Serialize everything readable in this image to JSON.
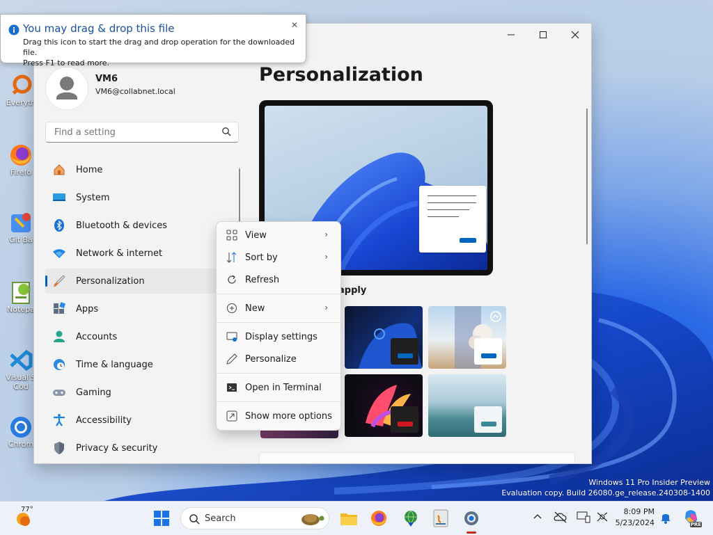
{
  "tooltip": {
    "title": "You may drag & drop this file",
    "line1": "Drag this icon to start the drag and drop operation for the downloaded file.",
    "line2": "Press F1 to read more."
  },
  "desktop_icons": [
    {
      "label": "Everyth",
      "icon": "search-app-icon"
    },
    {
      "label": "Firefo",
      "icon": "firefox-icon"
    },
    {
      "label": "Git Ba",
      "icon": "git-bash-icon"
    },
    {
      "label": "Notepa",
      "icon": "notepad-plus-icon"
    },
    {
      "label": "Visual S",
      "label2": "Cod",
      "icon": "vscode-icon"
    },
    {
      "label": "Chrom",
      "icon": "chrome-icon"
    }
  ],
  "settings": {
    "user_name": "VM6",
    "user_email": "VM6@collabnet.local",
    "search_placeholder": "Find a setting",
    "nav": [
      {
        "label": "Home",
        "icon": "home-icon"
      },
      {
        "label": "System",
        "icon": "system-icon"
      },
      {
        "label": "Bluetooth & devices",
        "icon": "bluetooth-icon"
      },
      {
        "label": "Network & internet",
        "icon": "wifi-icon"
      },
      {
        "label": "Personalization",
        "icon": "brush-icon",
        "active": true
      },
      {
        "label": "Apps",
        "icon": "apps-icon"
      },
      {
        "label": "Accounts",
        "icon": "accounts-icon"
      },
      {
        "label": "Time & language",
        "icon": "globe-clock-icon"
      },
      {
        "label": "Gaming",
        "icon": "gamepad-icon"
      },
      {
        "label": "Accessibility",
        "icon": "accessibility-icon"
      },
      {
        "label": "Privacy & security",
        "icon": "shield-icon"
      }
    ],
    "page_title": "Personalization",
    "theme_heading": "apply"
  },
  "context_menu": {
    "items": [
      {
        "label": "View",
        "icon": "grid-icon",
        "submenu": true
      },
      {
        "label": "Sort by",
        "icon": "sort-icon",
        "submenu": true
      },
      {
        "label": "Refresh",
        "icon": "refresh-icon",
        "submenu": false
      },
      {
        "label": "New",
        "icon": "plus-circle-icon",
        "submenu": true
      },
      {
        "label": "Display settings",
        "icon": "display-icon",
        "submenu": false
      },
      {
        "label": "Personalize",
        "icon": "pen-icon",
        "submenu": false
      },
      {
        "label": "Open in Terminal",
        "icon": "terminal-icon",
        "submenu": false
      },
      {
        "label": "Show more options",
        "icon": "more-options-icon",
        "submenu": false
      }
    ]
  },
  "watermark": {
    "line1": "Windows 11 Pro Insider Preview",
    "line2": "Evaluation copy. Build 26080.ge_release.240308-1400"
  },
  "taskbar": {
    "weather_temp": "77°",
    "search_label": "Search",
    "time": "8:09 PM",
    "date": "5/23/2024",
    "copilot_badge": "PRE"
  },
  "colors": {
    "accent": "#005fb8",
    "chip_blue": "#0067c0",
    "chip_red": "#d0161e"
  }
}
